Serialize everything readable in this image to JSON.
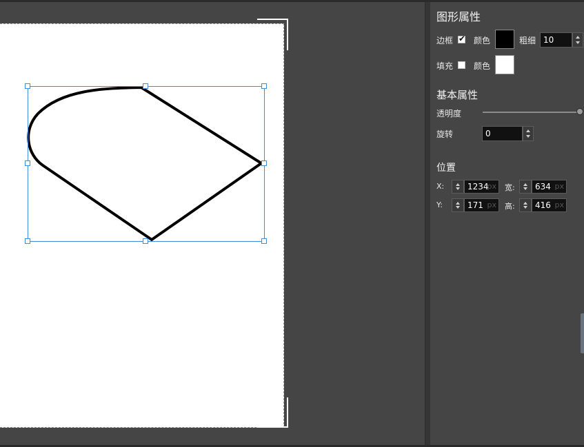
{
  "panel": {
    "shape_props_title": "图形属性",
    "border": {
      "label": "边框",
      "checked": true,
      "color_label": "颜色",
      "color": "#000000",
      "width_label": "粗细",
      "width_value": "10"
    },
    "fill": {
      "label": "填充",
      "checked": false,
      "color_label": "颜色",
      "color": "#ffffff"
    },
    "basic_title": "基本属性",
    "opacity_label": "透明度",
    "opacity": 1.0,
    "rotation_label": "旋转",
    "rotation_value": "0",
    "position_title": "位置",
    "x_label": "X:",
    "x_value": "1234",
    "x_unit": "px",
    "width_label": "宽:",
    "width_value": "634",
    "width_unit": "px",
    "y_label": "Y:",
    "y_value": "171",
    "y_unit": "px",
    "height_label": "高:",
    "height_value": "416",
    "height_unit": "px"
  },
  "colors": {
    "selection": "#3a8ee0",
    "stroke": "#000000"
  }
}
